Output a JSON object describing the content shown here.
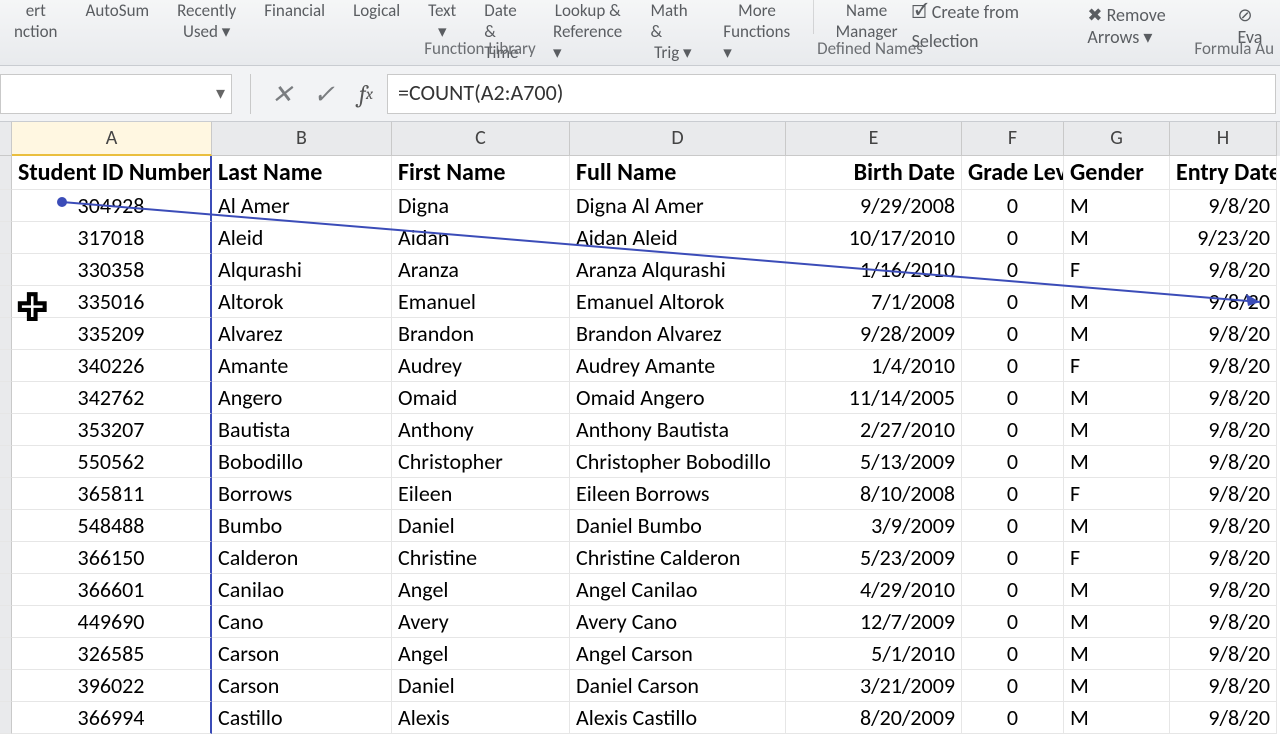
{
  "ribbon": {
    "buttons": [
      {
        "line1": "ert",
        "line2": "nction"
      },
      {
        "line1": "AutoSum",
        "line2": ""
      },
      {
        "line1": "Recently",
        "line2": "Used ▾"
      },
      {
        "line1": "Financial",
        "line2": ""
      },
      {
        "line1": "Logical",
        "line2": ""
      },
      {
        "line1": "Text",
        "line2": "▾"
      },
      {
        "line1": "Date &",
        "line2": "Time ▾"
      },
      {
        "line1": "Lookup &",
        "line2": "Reference ▾"
      },
      {
        "line1": "Math &",
        "line2": "Trig ▾"
      },
      {
        "line1": "More",
        "line2": "Functions ▾"
      },
      {
        "line1": "Name",
        "line2": "Manager"
      }
    ],
    "extra": {
      "create_from_selection": "Create from Selection",
      "remove_arrows": "Remove Arrows  ▾",
      "evaluate": "Eva"
    },
    "group_labels": {
      "function_library": "Function Library",
      "defined_names": "Defined Names",
      "formula_au": "Formula Au"
    }
  },
  "name_box": "",
  "formula": "=COUNT(A2:A700)",
  "column_letters": [
    "A",
    "B",
    "C",
    "D",
    "E",
    "F",
    "G",
    "H"
  ],
  "headers": [
    "Student ID Number",
    "Last Name",
    "First Name",
    "Full Name",
    "Birth Date",
    "Grade Level",
    "Gender",
    "Entry Date"
  ],
  "rows": [
    {
      "id": "304928",
      "last": "Al Amer",
      "first": "Digna",
      "full": "Digna Al Amer",
      "birth": "9/29/2008",
      "grade": "0",
      "gender": "M",
      "entry": "9/8/20"
    },
    {
      "id": "317018",
      "last": "Aleid",
      "first": "Aidan",
      "full": "Aidan Aleid",
      "birth": "10/17/2010",
      "grade": "0",
      "gender": "M",
      "entry": "9/23/20"
    },
    {
      "id": "330358",
      "last": "Alqurashi",
      "first": "Aranza",
      "full": "Aranza Alqurashi",
      "birth": "1/16/2010",
      "grade": "0",
      "gender": "F",
      "entry": "9/8/20"
    },
    {
      "id": "335016",
      "last": "Altorok",
      "first": "Emanuel",
      "full": "Emanuel Altorok",
      "birth": "7/1/2008",
      "grade": "0",
      "gender": "M",
      "entry": "9/8/20"
    },
    {
      "id": "335209",
      "last": "Alvarez",
      "first": "Brandon",
      "full": "Brandon Alvarez",
      "birth": "9/28/2009",
      "grade": "0",
      "gender": "M",
      "entry": "9/8/20"
    },
    {
      "id": "340226",
      "last": "Amante",
      "first": "Audrey",
      "full": "Audrey Amante",
      "birth": "1/4/2010",
      "grade": "0",
      "gender": "F",
      "entry": "9/8/20"
    },
    {
      "id": "342762",
      "last": "Angero",
      "first": "Omaid",
      "full": "Omaid Angero",
      "birth": "11/14/2005",
      "grade": "0",
      "gender": "M",
      "entry": "9/8/20"
    },
    {
      "id": "353207",
      "last": "Bautista",
      "first": "Anthony",
      "full": "Anthony Bautista",
      "birth": "2/27/2010",
      "grade": "0",
      "gender": "M",
      "entry": "9/8/20"
    },
    {
      "id": "550562",
      "last": "Bobodillo",
      "first": "Christopher",
      "full": "Christopher Bobodillo",
      "birth": "5/13/2009",
      "grade": "0",
      "gender": "M",
      "entry": "9/8/20"
    },
    {
      "id": "365811",
      "last": "Borrows",
      "first": "Eileen",
      "full": "Eileen Borrows",
      "birth": "8/10/2008",
      "grade": "0",
      "gender": "F",
      "entry": "9/8/20"
    },
    {
      "id": "548488",
      "last": "Bumbo",
      "first": "Daniel",
      "full": "Daniel Bumbo",
      "birth": "3/9/2009",
      "grade": "0",
      "gender": "M",
      "entry": "9/8/20"
    },
    {
      "id": "366150",
      "last": "Calderon",
      "first": "Christine",
      "full": "Christine Calderon",
      "birth": "5/23/2009",
      "grade": "0",
      "gender": "F",
      "entry": "9/8/20"
    },
    {
      "id": "366601",
      "last": "Canilao",
      "first": "Angel",
      "full": "Angel Canilao",
      "birth": "4/29/2010",
      "grade": "0",
      "gender": "M",
      "entry": "9/8/20"
    },
    {
      "id": "449690",
      "last": "Cano",
      "first": "Avery",
      "full": "Avery Cano",
      "birth": "12/7/2009",
      "grade": "0",
      "gender": "M",
      "entry": "9/8/20"
    },
    {
      "id": "326585",
      "last": "Carson",
      "first": "Angel",
      "full": "Angel Carson",
      "birth": "5/1/2010",
      "grade": "0",
      "gender": "M",
      "entry": "9/8/20"
    },
    {
      "id": "396022",
      "last": "Carson",
      "first": "Daniel",
      "full": "Daniel Carson",
      "birth": "3/21/2009",
      "grade": "0",
      "gender": "M",
      "entry": "9/8/20"
    },
    {
      "id": "366994",
      "last": "Castillo",
      "first": "Alexis",
      "full": "Alexis Castillo",
      "birth": "8/20/2009",
      "grade": "0",
      "gender": "M",
      "entry": "9/8/20"
    }
  ]
}
